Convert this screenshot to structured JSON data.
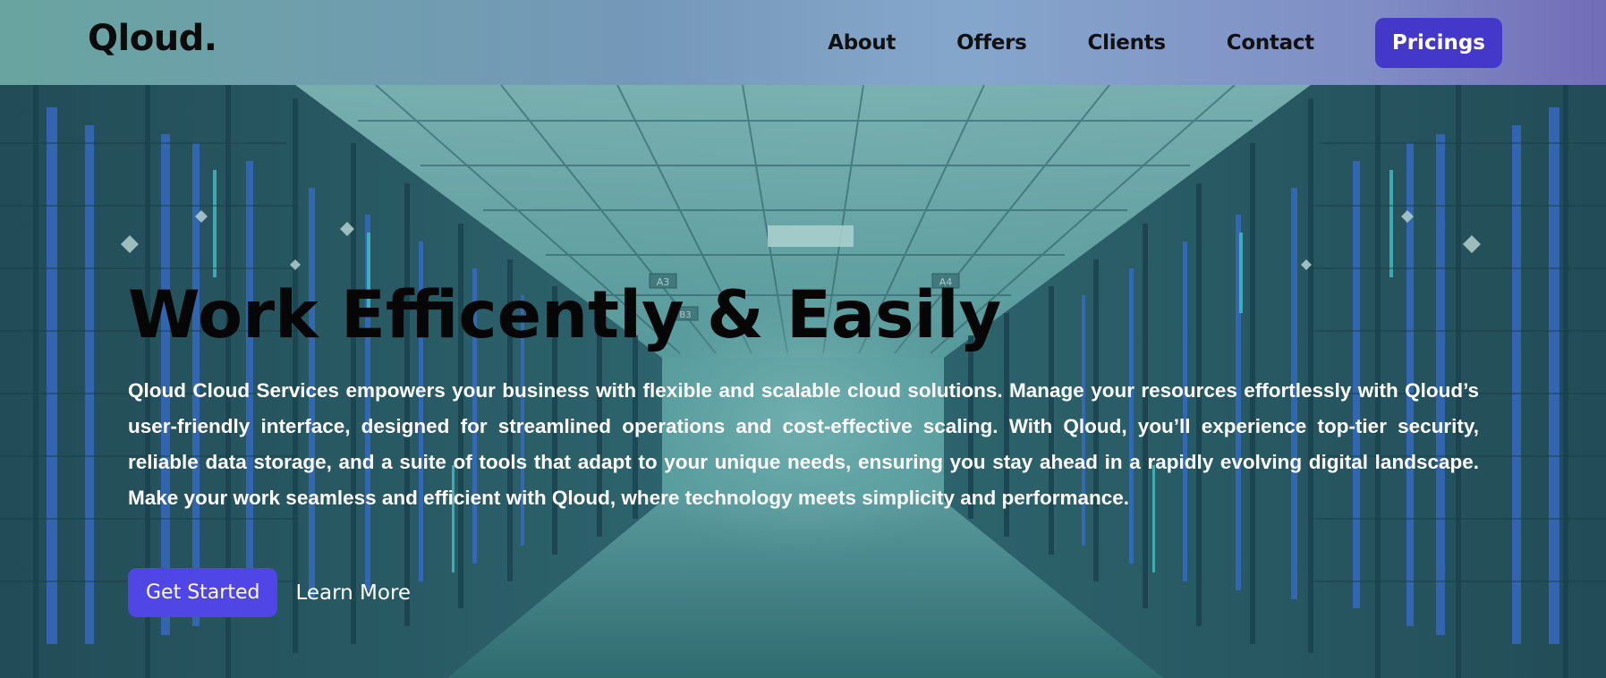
{
  "header": {
    "logo": "Qloud.",
    "nav": {
      "about": "About",
      "offers": "Offers",
      "clients": "Clients",
      "contact": "Contact"
    },
    "cta_label": "Pricings"
  },
  "hero": {
    "title": "Work Efficently & Easily",
    "description": "Qloud Cloud Services empowers your business with flexible and scalable cloud solutions. Manage your resources effortlessly with Qloud’s user-friendly interface, designed for streamlined operations and cost-effective scaling. With Qloud, you’ll experience top-tier security, reliable data storage, and a suite of tools that adapt to your unique needs, ensuring you stay ahead in a rapidly evolving digital landscape. Make your work seamless and efficient with Qloud, where technology meets simplicity and performance.",
    "primary_button": "Get Started",
    "secondary_button": "Learn More",
    "background_signs": {
      "sign_a3": "A3",
      "sign_a4": "A4",
      "sign_b3": "B3"
    }
  },
  "colors": {
    "accent": "#4f46e5",
    "cta": "#4338ca",
    "hero_tint": "#2e6e72"
  }
}
